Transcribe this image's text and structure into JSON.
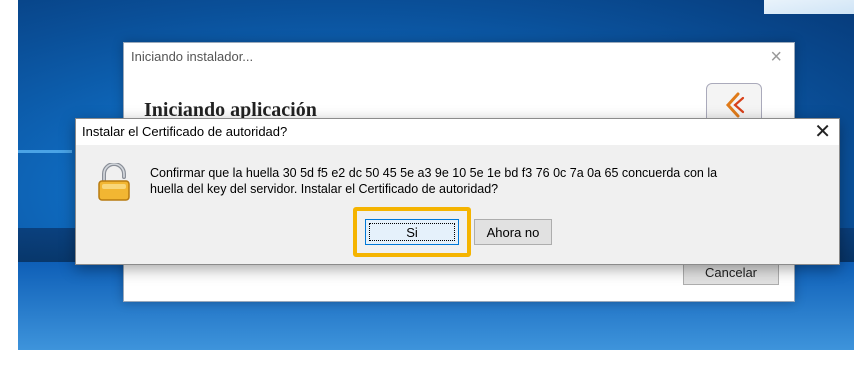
{
  "installer_window": {
    "title": "Iniciando instalador...",
    "heading": "Iniciando aplicación",
    "close_glyph": "×",
    "cancel_label": "Cancelar",
    "logo_icon": "java-logo-icon"
  },
  "dialog": {
    "title": "Instalar el Certificado de autoridad?",
    "close_glyph": "✕",
    "icon": "padlock-icon",
    "message_line1": "Confirmar que la huella 30 5d f5 e2 dc 50 45 5e a3 9e 10 5e 1e bd f3 76 0c 7a 0a 65 concuerda con la",
    "message_line2": "huella del key del servidor. Instalar el Certificado de autoridad?",
    "yes_label": "Si",
    "no_label": "Ahora no"
  },
  "colors": {
    "highlight": "#f5b400",
    "accent": "#0078d7",
    "desktop_blue": "#0f6bc0"
  }
}
